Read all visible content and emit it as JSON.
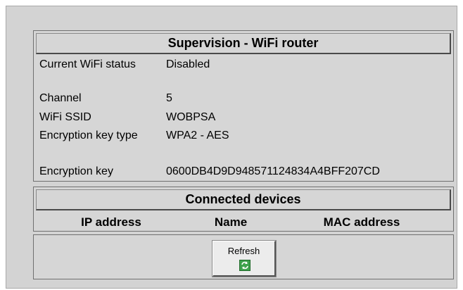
{
  "header": {
    "title": "Supervision - WiFi router"
  },
  "status": [
    {
      "label": "Current WiFi status",
      "value": "Disabled"
    },
    {
      "label": "Channel",
      "value": "5"
    },
    {
      "label": "WiFi SSID",
      "value": "WOBPSA"
    },
    {
      "label": "Encryption key type",
      "value": "WPA2 - AES"
    },
    {
      "label": "Encryption key",
      "value": "0600DB4D9D948571124834A4BFF207CD"
    }
  ],
  "devices": {
    "title": "Connected devices",
    "columns": [
      "IP address",
      "Name",
      "MAC address"
    ]
  },
  "actions": {
    "refresh_label": "Refresh",
    "refresh_icon": "refresh-icon",
    "icon_color": "#3fa34d"
  }
}
